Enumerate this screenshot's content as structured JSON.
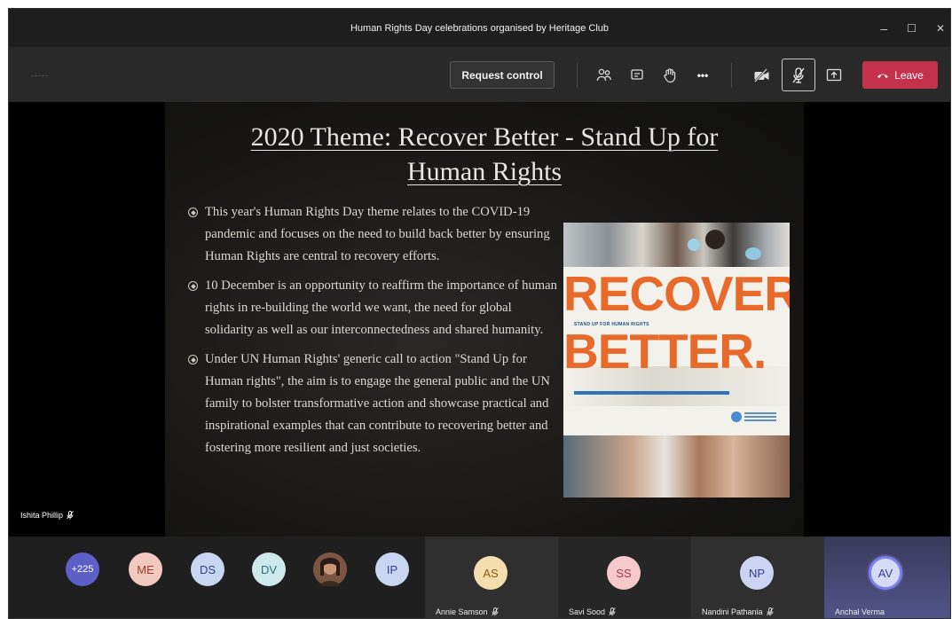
{
  "window": {
    "title": "Human Rights Day celebrations organised by Heritage Club",
    "controls": {
      "minimize": "–",
      "maximize": "☐",
      "close": "✕"
    }
  },
  "toolbar": {
    "timer": "·-·-·",
    "request_control_label": "Request control",
    "more_label": "•••",
    "leave_label": "Leave",
    "icons": [
      "participants-icon",
      "chat-icon",
      "raise-hand-icon",
      "more-icon",
      "camera-off-icon",
      "mic-off-icon",
      "share-icon",
      "phone-icon"
    ]
  },
  "slide": {
    "title_line1": "2020 Theme: Recover Better - Stand Up for",
    "title_line2": "Human Rights",
    "bullets": [
      "This year's Human Rights Day theme relates to the COVID-19 pandemic and focuses on the need to build back better by ensuring Human Rights are central to recovery efforts.",
      "10 December is an opportunity to reaffirm the importance of human rights in re-building the world we want, the need for global solidarity as well as our interconnectedness and shared humanity.",
      "Under UN Human Rights' generic call to action \"Stand Up for Human rights\", the aim is to engage the general public and the UN family to bolster transformative action and showcase practical and inspirational examples that can contribute to recovering better and fostering more resilient and just societies."
    ],
    "poster": {
      "word1": "RECOVER",
      "word2": "BETTER.",
      "tagline": "STAND UP FOR HUMAN RIGHTS",
      "accent_color": "#e86a2a"
    }
  },
  "speaker": {
    "name": "Ishita Phillip"
  },
  "participants": {
    "overflow_count": "+225",
    "avatars": [
      {
        "initials": "ME",
        "color": "#f2c9bf"
      },
      {
        "initials": "DS",
        "color": "#c9d6f2"
      },
      {
        "initials": "DV",
        "color": "#cfe8ec"
      },
      {
        "initials": "",
        "color": "#6b4a3a"
      },
      {
        "initials": "IP",
        "color": "#c9d6f2"
      }
    ],
    "tiles": [
      {
        "initials": "AS",
        "name": "Annie Samson",
        "color": "#f5ddb0"
      },
      {
        "initials": "SS",
        "name": "Savi Sood",
        "color": "#f6c9cc"
      },
      {
        "initials": "NP",
        "name": "Nandini Pathania",
        "color": "#cdd3f2"
      },
      {
        "initials": "AV",
        "name": "Anchal Verma",
        "color": "#d6dcf5"
      }
    ]
  }
}
